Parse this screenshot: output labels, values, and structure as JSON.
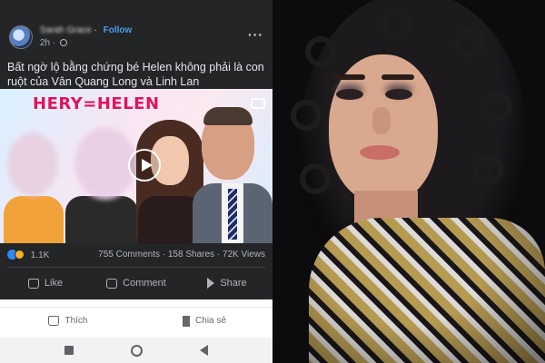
{
  "post": {
    "author": "Sarah Grace",
    "follow_label": "Follow",
    "time": "2h",
    "caption": "Bất ngờ lộ bằng chứng bé Helen không phải là con ruột của Vân Quang Long và Linh Lan",
    "video_title_text": "HERY=HELEN",
    "reaction_count": "1.1K",
    "comments": "755 Comments",
    "shares": "158 Shares",
    "views": "72K Views",
    "actions": {
      "like": "Like",
      "comment": "Comment",
      "share": "Share"
    }
  },
  "bottom_bar": {
    "like": "Thích",
    "share": "Chia sẻ"
  },
  "colors": {
    "post_bg": "#242526",
    "follow": "#4a9df0",
    "video_title": "#e0135c"
  },
  "icons": [
    "globe-icon",
    "more-icon",
    "play-icon",
    "cast-icon",
    "like-icon",
    "haha-icon",
    "comment-icon",
    "share-icon",
    "nav-recent-icon",
    "nav-home-icon",
    "nav-back-icon"
  ]
}
